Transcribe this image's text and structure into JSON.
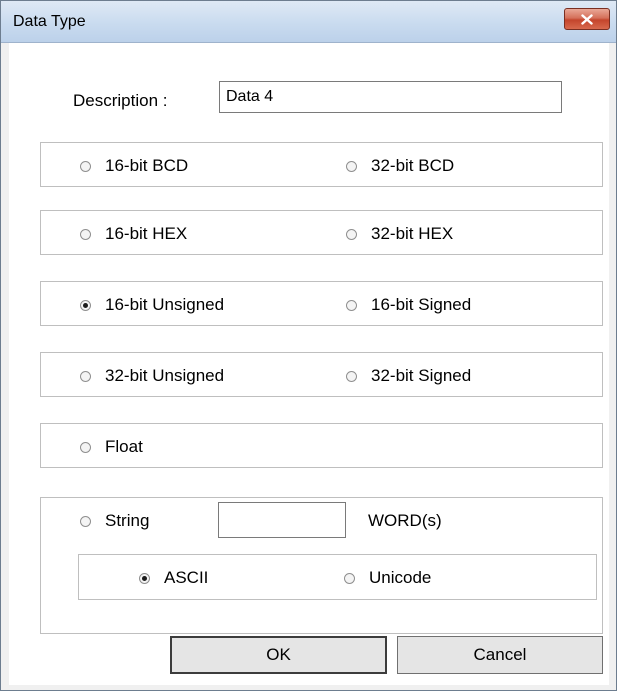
{
  "window": {
    "title": "Data Type"
  },
  "description": {
    "label": "Description :",
    "value": "Data 4"
  },
  "groups": [
    {
      "left": {
        "label": "16-bit BCD",
        "checked": false
      },
      "right": {
        "label": "32-bit BCD",
        "checked": false
      }
    },
    {
      "left": {
        "label": "16-bit HEX",
        "checked": false
      },
      "right": {
        "label": "32-bit HEX",
        "checked": false
      }
    },
    {
      "left": {
        "label": "16-bit Unsigned",
        "checked": true
      },
      "right": {
        "label": "16-bit Signed",
        "checked": false
      }
    },
    {
      "left": {
        "label": "32-bit Unsigned",
        "checked": false
      },
      "right": {
        "label": "32-bit Signed",
        "checked": false
      }
    },
    {
      "left": {
        "label": "Float",
        "checked": false
      }
    }
  ],
  "string": {
    "label": "String",
    "checked": false,
    "length_value": "",
    "unit_label": "WORD(s)",
    "encoding": {
      "ascii": {
        "label": "ASCII",
        "checked": true
      },
      "unicode": {
        "label": "Unicode",
        "checked": false
      }
    }
  },
  "buttons": {
    "ok": "OK",
    "cancel": "Cancel"
  }
}
